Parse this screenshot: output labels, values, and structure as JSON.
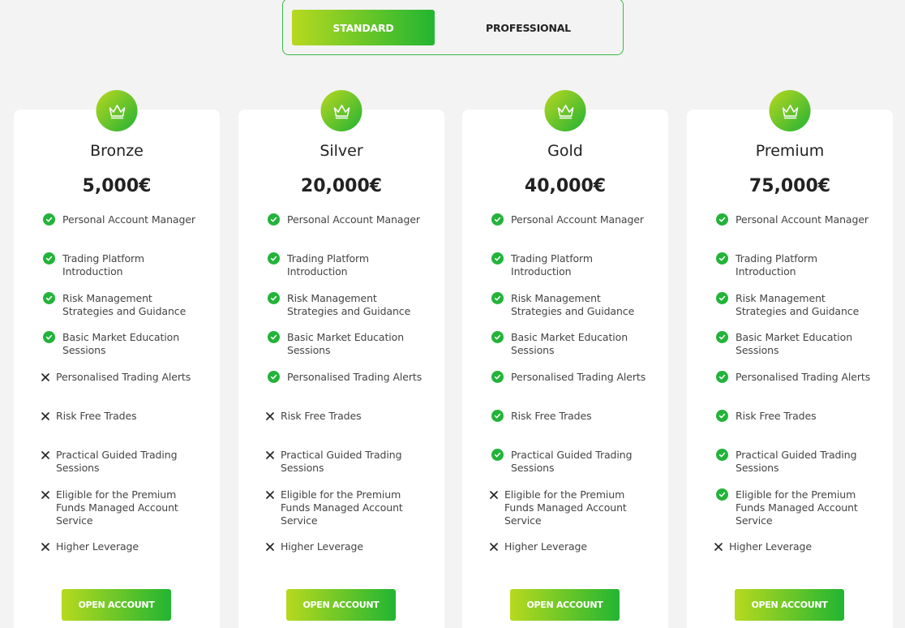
{
  "toggle": {
    "active_label": "STANDARD",
    "inactive_label": "PROFESSIONAL"
  },
  "colors": {
    "accent_start": "#b7d91f",
    "accent_end": "#22b532",
    "check": "#23b33a"
  },
  "icons": {
    "badge": "crown-icon",
    "included": "check-circle-icon",
    "excluded": "x-icon"
  },
  "plans": [
    {
      "name": "Bronze",
      "price": "5,000€",
      "cta": "OPEN ACCOUNT",
      "features": [
        {
          "label": "Personal Account Manager",
          "included": true
        },
        {
          "label": "Trading Platform Introduction",
          "included": true
        },
        {
          "label": "Risk Management Strategies and Guidance",
          "included": true
        },
        {
          "label": "Basic Market Education Sessions",
          "included": true
        },
        {
          "label": "Personalised Trading Alerts",
          "included": false
        },
        {
          "label": "Risk Free Trades",
          "included": false
        },
        {
          "label": "Practical Guided Trading Sessions",
          "included": false
        },
        {
          "label": "Eligible for the Premium Funds Managed Account Service",
          "included": false
        },
        {
          "label": "Higher Leverage",
          "included": false
        }
      ]
    },
    {
      "name": "Silver",
      "price": "20,000€",
      "cta": "OPEN ACCOUNT",
      "features": [
        {
          "label": "Personal Account Manager",
          "included": true
        },
        {
          "label": "Trading Platform Introduction",
          "included": true
        },
        {
          "label": "Risk Management Strategies and Guidance",
          "included": true
        },
        {
          "label": "Basic Market Education Sessions",
          "included": true
        },
        {
          "label": "Personalised Trading Alerts",
          "included": true
        },
        {
          "label": "Risk Free Trades",
          "included": false
        },
        {
          "label": "Practical Guided Trading Sessions",
          "included": false
        },
        {
          "label": "Eligible for the Premium Funds Managed Account Service",
          "included": false
        },
        {
          "label": "Higher Leverage",
          "included": false
        }
      ]
    },
    {
      "name": "Gold",
      "price": "40,000€",
      "cta": "OPEN ACCOUNT",
      "features": [
        {
          "label": "Personal Account Manager",
          "included": true
        },
        {
          "label": "Trading Platform Introduction",
          "included": true
        },
        {
          "label": "Risk Management Strategies and Guidance",
          "included": true
        },
        {
          "label": "Basic Market Education Sessions",
          "included": true
        },
        {
          "label": "Personalised Trading Alerts",
          "included": true
        },
        {
          "label": "Risk Free Trades",
          "included": true
        },
        {
          "label": "Practical Guided Trading Sessions",
          "included": true
        },
        {
          "label": "Eligible for the Premium Funds Managed Account Service",
          "included": false
        },
        {
          "label": "Higher Leverage",
          "included": false
        }
      ]
    },
    {
      "name": "Premium",
      "price": "75,000€",
      "cta": "OPEN ACCOUNT",
      "features": [
        {
          "label": "Personal Account Manager",
          "included": true
        },
        {
          "label": "Trading Platform Introduction",
          "included": true
        },
        {
          "label": "Risk Management Strategies and Guidance",
          "included": true
        },
        {
          "label": "Basic Market Education Sessions",
          "included": true
        },
        {
          "label": "Personalised Trading Alerts",
          "included": true
        },
        {
          "label": "Risk Free Trades",
          "included": true
        },
        {
          "label": "Practical Guided Trading Sessions",
          "included": true
        },
        {
          "label": "Eligible for the Premium Funds Managed Account Service",
          "included": true
        },
        {
          "label": "Higher Leverage",
          "included": false
        }
      ]
    }
  ]
}
